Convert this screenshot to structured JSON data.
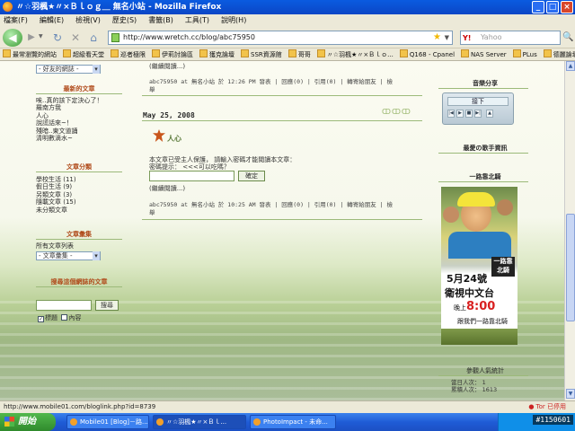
{
  "window": {
    "title": "〃☆羽楓★〃×Ｂｌｏｇ＿ 無名小站 - Mozilla Firefox",
    "controls": [
      "_",
      "□",
      "×"
    ]
  },
  "menu": [
    "檔案(F)",
    "編輯(E)",
    "檢視(V)",
    "歷史(S)",
    "書籤(B)",
    "工具(T)",
    "說明(H)"
  ],
  "nav": {
    "url": "http://www.wretch.cc/blog/abc75950",
    "search_placeholder": "Yahoo",
    "search_engine": "Y!"
  },
  "bookmarks": [
    "最常瀏覽的網站",
    "超級看天堂",
    "巡者極限",
    "伊莉討論區",
    "獲克論壇",
    "SSR資源館",
    "哥哥",
    "〃☆羽楓★〃×Ｂｌｏ...",
    "Q168 - Cpanel",
    "NAS Server",
    "PLus",
    "德麗論壇"
  ],
  "left": {
    "top_select": "- 好友的網誌 -",
    "recent_title": "最新的文章",
    "recent_items": [
      "唉..真的該下定決心了！",
      "羅南方我",
      "人心",
      "說謊話來~！",
      "殘暗..東文道誦",
      "清明數滴水~"
    ],
    "category_title": "文章分類",
    "category_items": [
      "學校生活 (11)",
      "假日生活 (9)",
      "另類文章 (3)",
      "隨載文章 (15)",
      "未分類文章"
    ],
    "collection_title": "文章彙集",
    "collection_label": "所有文章列表",
    "collection_select": "- 文章彙集 -",
    "search_title": "搜尋這個網誌的文章",
    "search_button": "搜尋",
    "check_title": "標題",
    "check_content": "內容"
  },
  "post1": {
    "read_more": "(繼續閱讀...)",
    "meta": "abc75950 at 無名小站 於 12:26 PM 發表 | 回應(0) | 引用(0) | 轉寄給朋友 | 檢",
    "meta2": "舉"
  },
  "post2": {
    "date": "May 25, 2008",
    "title": "人心",
    "protected_text": "本文章已受主人保護， 請輸入密碼才能閱讀本文章：",
    "hint": "密碼提示： <<<可以吃嗎？",
    "submit": "確定",
    "read_more": "(繼續閱讀...)",
    "meta": "abc75950 at 無名小站 於 10:25 AM 發表 | 回應(0) | 引用(0) | 轉寄給朋友 | 檢",
    "meta2": "舉"
  },
  "right": {
    "music_title": "音樂分享",
    "player_display": "接下",
    "player_controls": [
      "|◀",
      "▶",
      "■",
      "▶|",
      "▲"
    ],
    "fav_singer": "最愛の歌手資訊",
    "poster_title": "一路靠北騎",
    "poster_date": "5月24號",
    "poster_channel": "衛視中文台",
    "poster_time_prefix": "晚上",
    "poster_time": "8:00",
    "poster_footer": "跟我們一路靠北騎",
    "poster_badge": "一路靠北騎",
    "stats_title": "參觀人氣統計",
    "today_label": "當日人次：",
    "today_value": "1",
    "total_label": "累積人次：",
    "total_value": "1613"
  },
  "status": {
    "url": "http://www.mobile01.com/bloglink.php?id=8739",
    "tor": "Tor 已停用"
  },
  "taskbar": {
    "start": "開始",
    "tasks": [
      "Mobile01 [Blog]－路...",
      "〃☆羽楓★〃×Ｂｌ...",
      "PhotoImpact - 未命..."
    ],
    "tag": "#1150601"
  }
}
